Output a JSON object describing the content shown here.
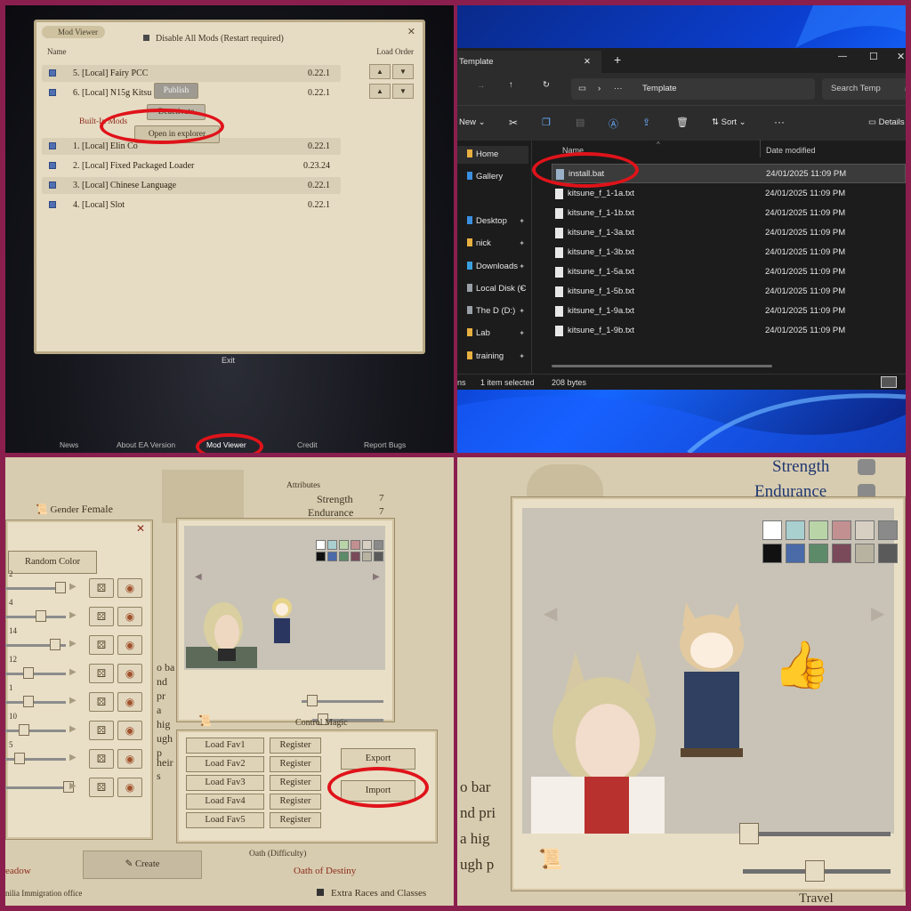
{
  "panel1": {
    "window_title": "Mod Viewer",
    "disable_all": "Disable All Mods (Restart required)",
    "col_name": "Name",
    "col_load_order": "Load Order",
    "mods_top": [
      {
        "name": "5. [Local] Fairy PCC",
        "version": "0.22.1"
      },
      {
        "name": "6. [Local] N15g Kitsu",
        "version": "0.22.1"
      }
    ],
    "builtin_label": "Built-In Mods",
    "mods_builtin": [
      {
        "name": "1. [Local] Elin Co",
        "version": "0.22.1"
      },
      {
        "name": "2. [Local] Fixed Packaged Loader",
        "version": "0.23.24"
      },
      {
        "name": "3. [Local] Chinese Language",
        "version": "0.22.1"
      },
      {
        "name": "4. [Local] Slot",
        "version": "0.22.1"
      }
    ],
    "context_menu": [
      "Publish",
      "Deactivate",
      "Open in explorer"
    ],
    "exit": "Exit",
    "bottom_menu": [
      "News",
      "About EA Version",
      "Mod Viewer",
      "Credit",
      "Report Bugs"
    ]
  },
  "panel2": {
    "tab_title": "Template",
    "path": "Template",
    "search_placeholder": "Search Temp",
    "toolbar": {
      "new": "New",
      "sort": "Sort",
      "details": "Details"
    },
    "nav_items": [
      {
        "label": "Home",
        "color": "#e8b040"
      },
      {
        "label": "Gallery",
        "color": "#3a8fe0"
      },
      {
        "label": "Desktop",
        "color": "#3a8fe0"
      },
      {
        "label": "nick",
        "color": "#e8b040"
      },
      {
        "label": "Downloads",
        "color": "#3aa0e0"
      },
      {
        "label": "Local Disk (C",
        "color": "#9aa0a8"
      },
      {
        "label": "The D (D:)",
        "color": "#9aa0a8"
      },
      {
        "label": "Lab",
        "color": "#e8b040"
      },
      {
        "label": "training",
        "color": "#e8b040"
      }
    ],
    "col_name": "Name",
    "col_date": "Date modified",
    "files": [
      {
        "name": "install.bat",
        "date": "24/01/2025 11:09 PM"
      },
      {
        "name": "kitsune_f_1-1a.txt",
        "date": "24/01/2025 11:09 PM"
      },
      {
        "name": "kitsune_f_1-1b.txt",
        "date": "24/01/2025 11:09 PM"
      },
      {
        "name": "kitsune_f_1-3a.txt",
        "date": "24/01/2025 11:09 PM"
      },
      {
        "name": "kitsune_f_1-3b.txt",
        "date": "24/01/2025 11:09 PM"
      },
      {
        "name": "kitsune_f_1-5a.txt",
        "date": "24/01/2025 11:09 PM"
      },
      {
        "name": "kitsune_f_1-5b.txt",
        "date": "24/01/2025 11:09 PM"
      },
      {
        "name": "kitsune_f_1-9a.txt",
        "date": "24/01/2025 11:09 PM"
      },
      {
        "name": "kitsune_f_1-9b.txt",
        "date": "24/01/2025 11:09 PM"
      }
    ],
    "status_left": "ns",
    "status_selected": "1 item selected",
    "status_size": "208 bytes"
  },
  "panel3": {
    "attributes": "Attributes",
    "strength": "Strength",
    "strength_val": "7",
    "endurance": "Endurance",
    "endurance_val": "7",
    "gender_label": "Gender",
    "gender_value": "Female",
    "random_color": "Random Color",
    "slider_numbers": [
      "2",
      "4",
      "14",
      "12",
      "1",
      "10",
      "5"
    ],
    "fav_buttons": [
      "Load Fav1",
      "Load Fav2",
      "Load Fav3",
      "Load Fav4",
      "Load Fav5"
    ],
    "register": "Register",
    "export": "Export",
    "import": "Import",
    "create": "Create",
    "oath_label": "Oath (Difficulty)",
    "oath_value": "Oath of Destiny",
    "extra_races": "Extra Races and Classes",
    "immigration": "nilia Immigration office",
    "meadow": "eadow",
    "control_magic": "Control Magic",
    "bg_text": [
      "o ba",
      "nd pr",
      "a hig",
      "ugh p",
      "heir s"
    ]
  },
  "panel4": {
    "strength": "Strength",
    "endurance": "Endurance",
    "travel": "Travel",
    "bg_text": [
      "o bar",
      "nd pri",
      "a hig",
      "ugh p"
    ]
  },
  "swatches_row1": [
    "#ffffff",
    "#a9cfcf",
    "#b9d5a8",
    "#c29090",
    "#d7d0c2",
    "#8a8a8a"
  ],
  "swatches_row2": [
    "#111111",
    "#4a6aa8",
    "#5d8a68",
    "#7a4a5a",
    "#b8b2a0",
    "#5a5a5a"
  ]
}
